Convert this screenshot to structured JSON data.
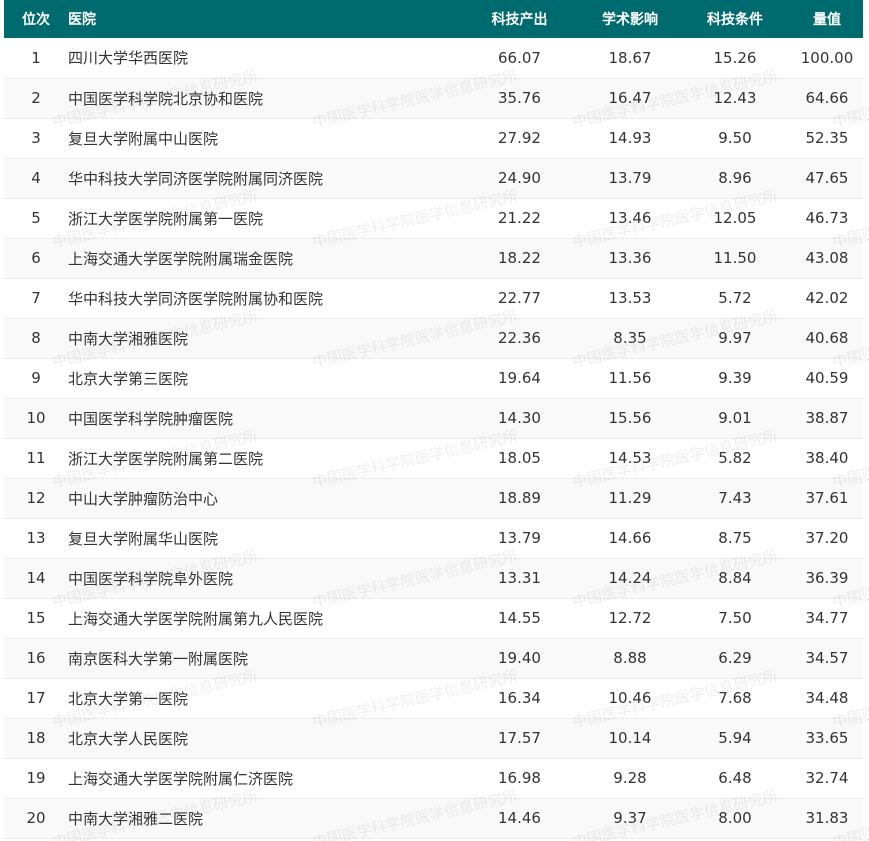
{
  "table": {
    "headers": {
      "rank": "位次",
      "hospital": "医院",
      "sci_output": "科技产出",
      "academic_impact": "学术影响",
      "sci_conditions": "科技条件",
      "score": "量值"
    },
    "rows": [
      {
        "rank": "1",
        "hospital": "四川大学华西医院",
        "sci_output": "66.07",
        "academic_impact": "18.67",
        "sci_conditions": "15.26",
        "score": "100.00"
      },
      {
        "rank": "2",
        "hospital": "中国医学科学院北京协和医院",
        "sci_output": "35.76",
        "academic_impact": "16.47",
        "sci_conditions": "12.43",
        "score": "64.66"
      },
      {
        "rank": "3",
        "hospital": "复旦大学附属中山医院",
        "sci_output": "27.92",
        "academic_impact": "14.93",
        "sci_conditions": "9.50",
        "score": "52.35"
      },
      {
        "rank": "4",
        "hospital": "华中科技大学同济医学院附属同济医院",
        "sci_output": "24.90",
        "academic_impact": "13.79",
        "sci_conditions": "8.96",
        "score": "47.65"
      },
      {
        "rank": "5",
        "hospital": "浙江大学医学院附属第一医院",
        "sci_output": "21.22",
        "academic_impact": "13.46",
        "sci_conditions": "12.05",
        "score": "46.73"
      },
      {
        "rank": "6",
        "hospital": "上海交通大学医学院附属瑞金医院",
        "sci_output": "18.22",
        "academic_impact": "13.36",
        "sci_conditions": "11.50",
        "score": "43.08"
      },
      {
        "rank": "7",
        "hospital": "华中科技大学同济医学院附属协和医院",
        "sci_output": "22.77",
        "academic_impact": "13.53",
        "sci_conditions": "5.72",
        "score": "42.02"
      },
      {
        "rank": "8",
        "hospital": "中南大学湘雅医院",
        "sci_output": "22.36",
        "academic_impact": "8.35",
        "sci_conditions": "9.97",
        "score": "40.68"
      },
      {
        "rank": "9",
        "hospital": "北京大学第三医院",
        "sci_output": "19.64",
        "academic_impact": "11.56",
        "sci_conditions": "9.39",
        "score": "40.59"
      },
      {
        "rank": "10",
        "hospital": "中国医学科学院肿瘤医院",
        "sci_output": "14.30",
        "academic_impact": "15.56",
        "sci_conditions": "9.01",
        "score": "38.87"
      },
      {
        "rank": "11",
        "hospital": "浙江大学医学院附属第二医院",
        "sci_output": "18.05",
        "academic_impact": "14.53",
        "sci_conditions": "5.82",
        "score": "38.40"
      },
      {
        "rank": "12",
        "hospital": "中山大学肿瘤防治中心",
        "sci_output": "18.89",
        "academic_impact": "11.29",
        "sci_conditions": "7.43",
        "score": "37.61"
      },
      {
        "rank": "13",
        "hospital": "复旦大学附属华山医院",
        "sci_output": "13.79",
        "academic_impact": "14.66",
        "sci_conditions": "8.75",
        "score": "37.20"
      },
      {
        "rank": "14",
        "hospital": "中国医学科学院阜外医院",
        "sci_output": "13.31",
        "academic_impact": "14.24",
        "sci_conditions": "8.84",
        "score": "36.39"
      },
      {
        "rank": "15",
        "hospital": "上海交通大学医学院附属第九人民医院",
        "sci_output": "14.55",
        "academic_impact": "12.72",
        "sci_conditions": "7.50",
        "score": "34.77"
      },
      {
        "rank": "16",
        "hospital": "南京医科大学第一附属医院",
        "sci_output": "19.40",
        "academic_impact": "8.88",
        "sci_conditions": "6.29",
        "score": "34.57"
      },
      {
        "rank": "17",
        "hospital": "北京大学第一医院",
        "sci_output": "16.34",
        "academic_impact": "10.46",
        "sci_conditions": "7.68",
        "score": "34.48"
      },
      {
        "rank": "18",
        "hospital": "北京大学人民医院",
        "sci_output": "17.57",
        "academic_impact": "10.14",
        "sci_conditions": "5.94",
        "score": "33.65"
      },
      {
        "rank": "19",
        "hospital": "上海交通大学医学院附属仁济医院",
        "sci_output": "16.98",
        "academic_impact": "9.28",
        "sci_conditions": "6.48",
        "score": "32.74"
      },
      {
        "rank": "20",
        "hospital": "中南大学湘雅二医院",
        "sci_output": "14.46",
        "academic_impact": "9.37",
        "sci_conditions": "8.00",
        "score": "31.83"
      }
    ]
  },
  "watermark": {
    "text": "中国医学科学院医学信息研究所"
  },
  "colors": {
    "header_bg": "#006b6e",
    "header_text": "#ffffff",
    "body_text": "#333333",
    "row_alt_bg": "#f9f9f9"
  }
}
